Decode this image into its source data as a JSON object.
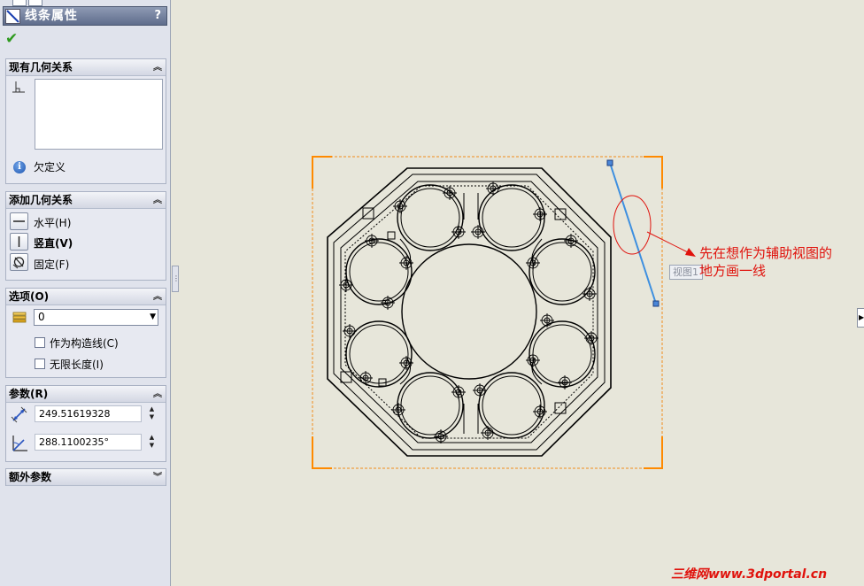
{
  "panel": {
    "title": "线条属性",
    "help": "?",
    "existing_relations": {
      "header": "现有几何关系",
      "status": "欠定义"
    },
    "add_relations": {
      "header": "添加几何关系",
      "items": [
        {
          "label": "水平(H)",
          "icon": "horizontal-icon"
        },
        {
          "label": "竖直(V)",
          "icon": "vertical-icon"
        },
        {
          "label": "固定(F)",
          "icon": "fix-icon"
        }
      ]
    },
    "options": {
      "header": "选项(O)",
      "layer_value": "0",
      "construction_label": "作为构造线(C)",
      "infinite_label": "无限长度(I)"
    },
    "parameters": {
      "header": "参数(R)",
      "length": "249.51619328",
      "angle": "288.1100235°"
    },
    "extra": {
      "header": "额外参数"
    }
  },
  "canvas": {
    "view_label": "视图1",
    "annotation_line1": "先在想作为辅助视图的",
    "annotation_line2": "地方画一线",
    "watermark": "三维网www.3dportal.cn"
  },
  "colors": {
    "sketch_line": "#3d8fe0",
    "view_corner": "#ff8a00",
    "annotation": "#e0120c",
    "title_bar": "#6a7795"
  }
}
